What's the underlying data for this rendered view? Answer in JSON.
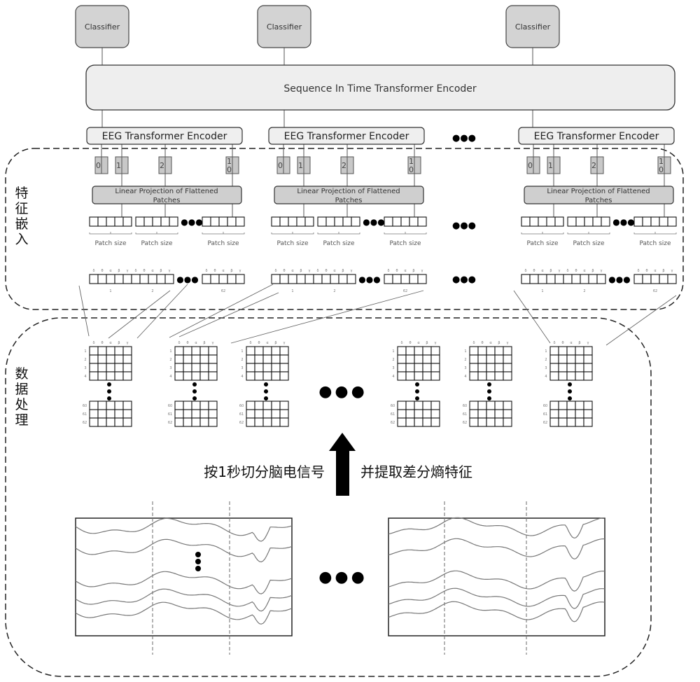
{
  "classifiers": [
    "Classifier",
    "Classifier",
    "Classifier"
  ],
  "sequence_encoder": {
    "label": "Sequence In Time Transformer Encoder"
  },
  "eeg_encoders": [
    {
      "label": "EEG Transformer Encoder",
      "tokens": [
        "0",
        "1",
        "2",
        "1\n0"
      ],
      "projection": "Linear Projection of Flattened Patches"
    },
    {
      "label": "EEG Transformer Encoder",
      "tokens": [
        "0",
        "1",
        "2",
        "1\n0"
      ],
      "projection": "Linear Projection of Flattened Patches"
    },
    {
      "label": "EEG Transformer Encoder",
      "tokens": [
        "0",
        "1",
        "2",
        "1\n0"
      ],
      "projection": "Linear Projection of Flattened Patches"
    }
  ],
  "patch_size_label": "Patch size",
  "bands": [
    "δ",
    "θ",
    "α",
    "β",
    "γ"
  ],
  "flat_indices": [
    "1",
    "2",
    "62"
  ],
  "matrix_row_labels_top": [
    "1",
    "2",
    "3",
    "4"
  ],
  "matrix_row_labels_bottom": [
    "60",
    "61",
    "62"
  ],
  "section_labels": {
    "feature_embedding": "特征嵌入",
    "data_processing": "数据处理"
  },
  "arrow_caption_left": "按1秒切分脑电信号",
  "arrow_caption_right": "并提取差分熵特征",
  "ellipsis": "●●●"
}
